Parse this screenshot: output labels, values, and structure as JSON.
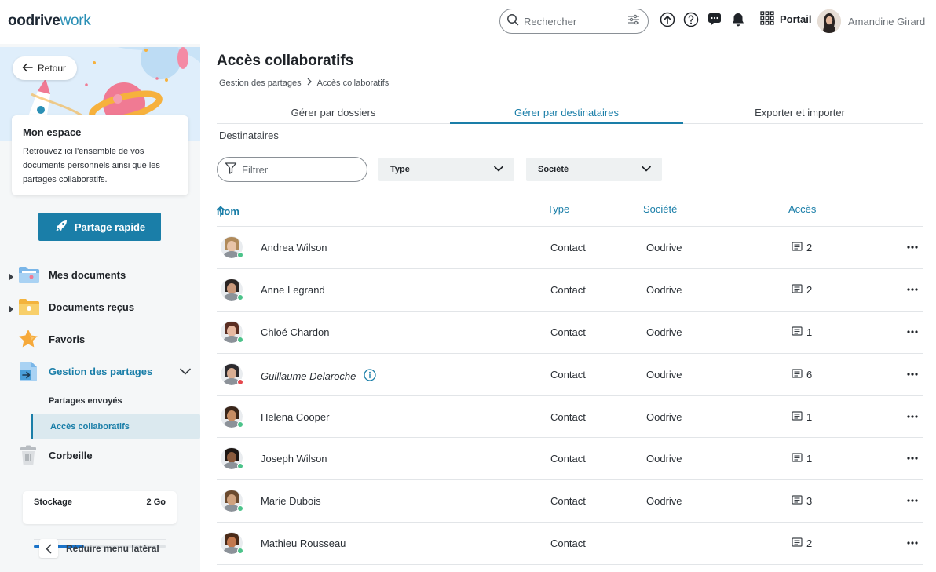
{
  "header": {
    "logo_brand": "oodrive",
    "logo_suffix": "work",
    "search_placeholder": "Rechercher",
    "portal_label": "Portail",
    "user_name": "Amandine Girard"
  },
  "sidebar": {
    "back_label": "Retour",
    "card_title": "Mon espace",
    "card_text": "Retrouvez ici l'ensemble de vos documents personnels ainsi que les partages collaboratifs.",
    "quick_share_label": "Partage rapide",
    "nav": [
      {
        "label": "Mes documents",
        "icon": "folder-icon"
      },
      {
        "label": "Documents reçus",
        "icon": "received-folder-icon"
      },
      {
        "label": "Favoris",
        "icon": "star-icon"
      },
      {
        "label": "Gestion des partages",
        "icon": "share-management-icon"
      },
      {
        "label": "Corbeille",
        "icon": "trash-icon"
      }
    ],
    "sub_nav": [
      {
        "label": "Partages envoyés"
      },
      {
        "label": "Accès collaboratifs"
      }
    ],
    "storage": {
      "label": "Stockage",
      "value": "2 Go",
      "fraction": 0.38
    },
    "collapse_label": "Réduire menu latéral"
  },
  "main": {
    "title": "Accès collaboratifs",
    "breadcrumb": [
      "Gestion des partages",
      "Accès collaboratifs"
    ],
    "tabs": [
      {
        "label": "Gérer par dossiers"
      },
      {
        "label": "Gérer par destinataires"
      },
      {
        "label": "Exporter et importer"
      }
    ],
    "section_label": "Destinataires",
    "filter_placeholder": "Filtrer",
    "select_type": "Type",
    "select_company": "Société",
    "columns": {
      "name": "Nom",
      "type": "Type",
      "company": "Société",
      "access": "Accès"
    },
    "rows": [
      {
        "name": "Andrea Wilson",
        "type": "Contact",
        "company": "Oodrive",
        "access": "2",
        "status": "online",
        "skin": "#e8c4a8",
        "hair": "#b08a5a"
      },
      {
        "name": "Anne Legrand",
        "type": "Contact",
        "company": "Oodrive",
        "access": "2",
        "status": "online",
        "skin": "#c9987a",
        "hair": "#2a2422"
      },
      {
        "name": "Chloé Chardon",
        "type": "Contact",
        "company": "Oodrive",
        "access": "1",
        "status": "online",
        "skin": "#e6b8a0",
        "hair": "#5a2e22"
      },
      {
        "name": "Guillaume Delaroche",
        "type": "Contact",
        "company": "Oodrive",
        "access": "6",
        "status": "offline",
        "skin": "#d8ad92",
        "hair": "#2c2a2e",
        "italic": true,
        "info": true
      },
      {
        "name": "Helena Cooper",
        "type": "Contact",
        "company": "Oodrive",
        "access": "1",
        "status": "online",
        "skin": "#c68d64",
        "hair": "#3a261a"
      },
      {
        "name": "Joseph Wilson",
        "type": "Contact",
        "company": "Oodrive",
        "access": "1",
        "status": "online",
        "skin": "#8a5a3c",
        "hair": "#1d1613"
      },
      {
        "name": "Marie Dubois",
        "type": "Contact",
        "company": "Oodrive",
        "access": "3",
        "status": "online",
        "skin": "#cfa27e",
        "hair": "#6b4a2e"
      },
      {
        "name": "Mathieu Rousseau",
        "type": "Contact",
        "company": "",
        "access": "2",
        "status": "online",
        "skin": "#c2784e",
        "hair": "#4a2a18"
      }
    ]
  },
  "colors": {
    "accent": "#1a7ea8",
    "online": "#4cc38a",
    "offline": "#e5484d"
  }
}
